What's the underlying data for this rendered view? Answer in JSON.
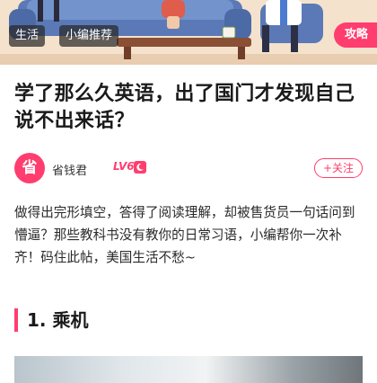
{
  "hero": {
    "tags": [
      "生活",
      "小编推荐"
    ],
    "badge": "攻略"
  },
  "article": {
    "title": "学了那么久英语，出了国门才发现自己说不出来话？",
    "intro": "做得出完形填空，答得了阅读理解，却被售货员一句话问到懵逼？那些教科书没有教你的日常习语，小编帮你一次补齐！码住此帖，美国生活不愁~"
  },
  "author": {
    "avatar_char": "省",
    "name": "省钱君",
    "level": "LV6",
    "follow_label": "+关注"
  },
  "section": {
    "title": "1. 乘机"
  },
  "colors": {
    "accent": "#ff3d6e",
    "tag_bg": "#3a3a3a",
    "text": "#222222"
  },
  "icons": [
    "moon-icon",
    "plus-icon"
  ]
}
